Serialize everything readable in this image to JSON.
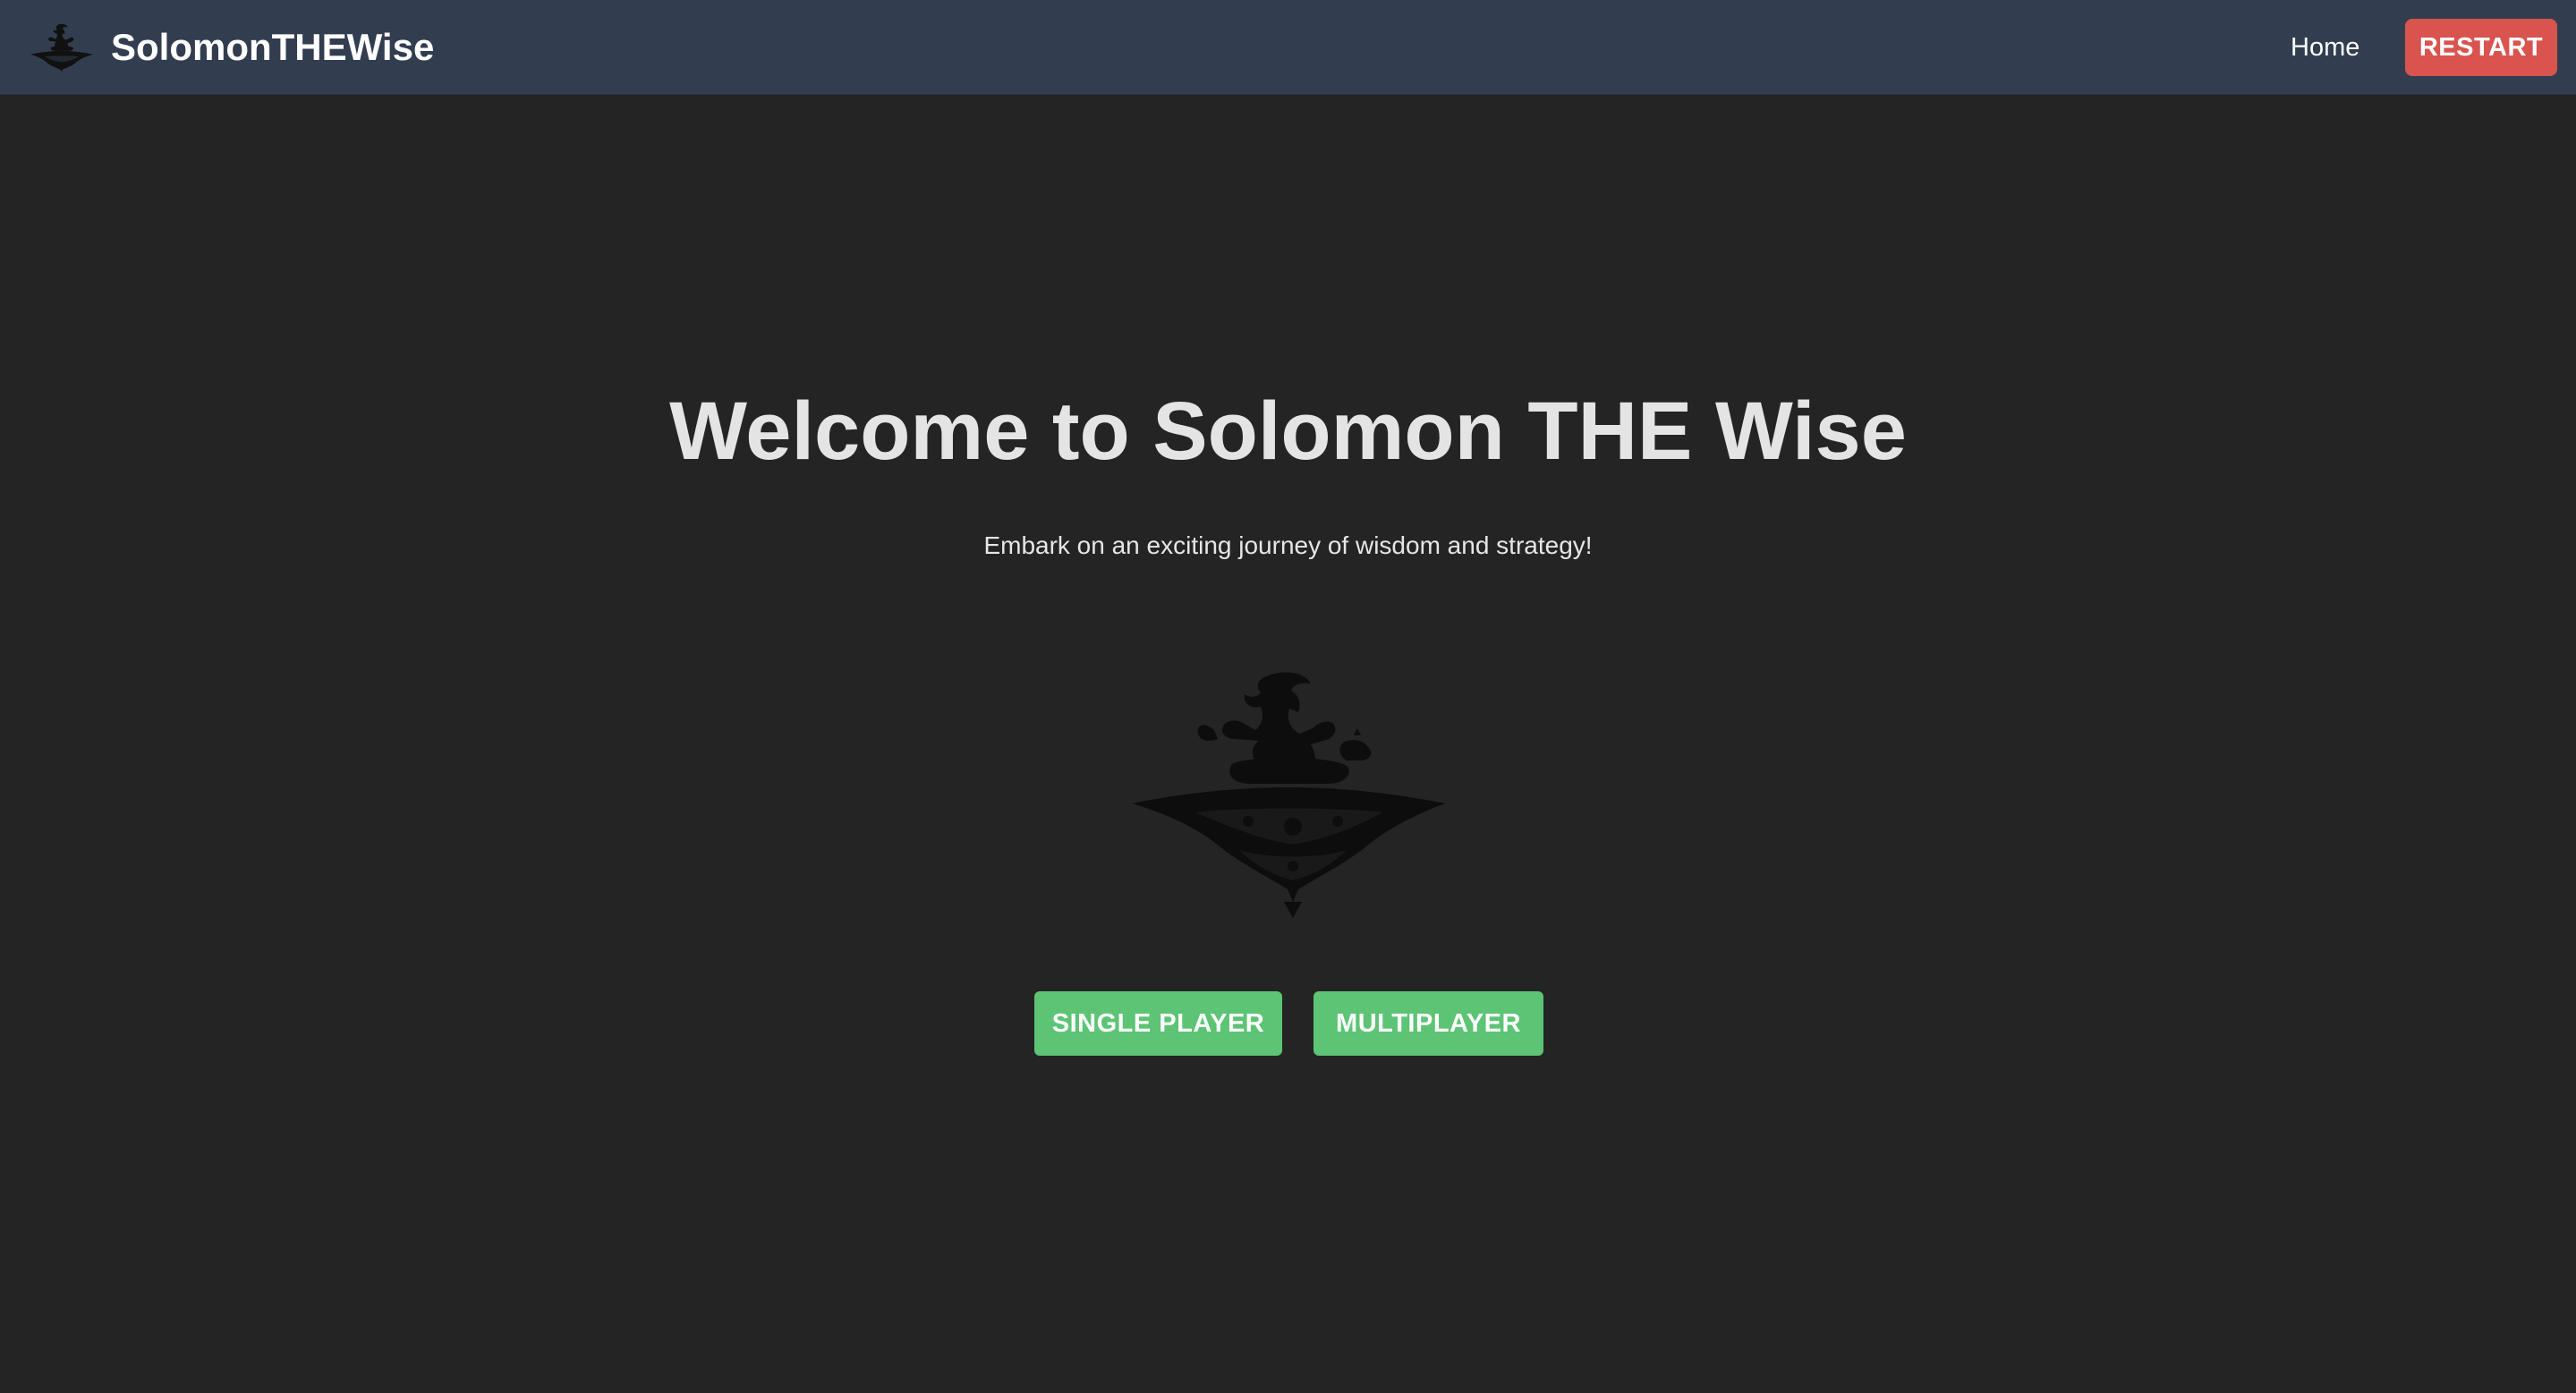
{
  "navbar": {
    "brand_name": "SolomonTHEWise",
    "brand_logo_icon": "genie-on-flying-carpet-icon",
    "home_link": "Home",
    "restart_button": "RESTART",
    "background_color": "#323e4f",
    "restart_color": "#d9534f"
  },
  "hero": {
    "title": "Welcome to Solomon THE Wise",
    "subtitle": "Embark on an exciting journey of wisdom and strategy!",
    "logo_icon": "genie-on-flying-carpet-icon",
    "buttons": {
      "single_player": "SINGLE PLAYER",
      "multiplayer": "MULTIPLAYER"
    },
    "button_color": "#5cc474"
  },
  "page": {
    "background_color": "#242424"
  }
}
